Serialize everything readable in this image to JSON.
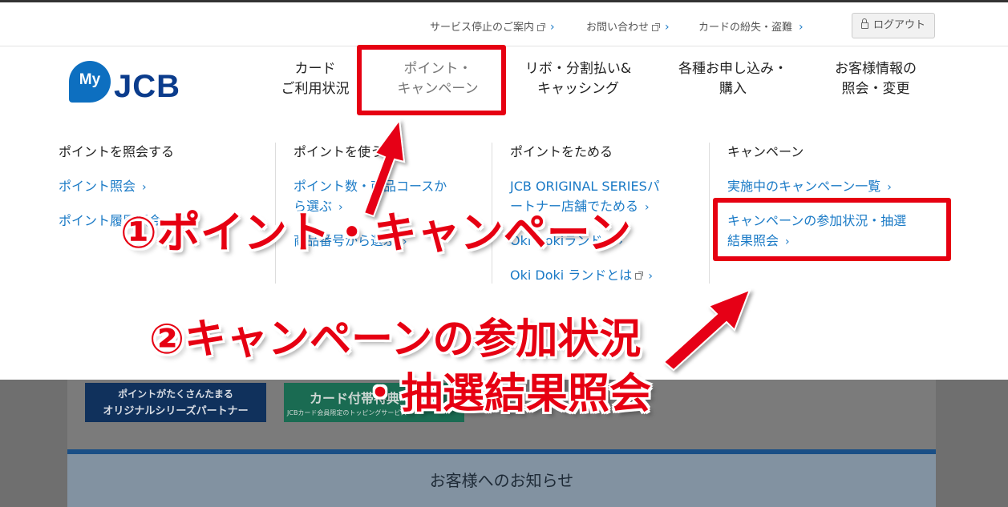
{
  "utility_nav": {
    "service_stop": "サービス停止のご案内",
    "contact": "お問い合わせ",
    "lost_card": "カードの紛失・盗難",
    "logout": "ログアウト"
  },
  "logo": {
    "my": "My",
    "jcb": "JCB"
  },
  "main_nav": [
    {
      "line1": "カード",
      "line2": "ご利用状況"
    },
    {
      "line1": "ポイント・",
      "line2": "キャンペーン"
    },
    {
      "line1": "リボ・分割払い&",
      "line2": "キャッシング"
    },
    {
      "line1": "各種お申し込み・",
      "line2": "購入"
    },
    {
      "line1": "お客様情報の",
      "line2": "照会・変更"
    }
  ],
  "menu": {
    "col1": {
      "heading": "ポイントを照会する",
      "link1": "ポイント照会",
      "link2": "ポイント履歴照会"
    },
    "col2": {
      "heading": "ポイントを使う",
      "link1a": "ポイント数・商品コースか",
      "link1b": "ら選ぶ",
      "link2": "商品番号から選ぶ"
    },
    "col3": {
      "heading": "ポイントをためる",
      "link1a": "JCB ORIGINAL SERIESパ",
      "link1b": "ートナー店舗でためる",
      "link2": "Oki Dokiランド",
      "link3": "Oki Doki ランドとは"
    },
    "col4": {
      "heading": "キャンペーン",
      "link1": "実施中のキャンペーン一覧",
      "link2a": "キャンペーンの参加状況・抽選",
      "link2b": "結果照会"
    }
  },
  "banners": {
    "banner1_line1": "ポイントがたくさんたまる",
    "banner1_line2": "オリジナルシリーズパートナー",
    "banner2_title": "カード付帯特典",
    "banner2_sub": "JCBカード会員限定のトッピングサービス"
  },
  "notice": "お客様へのお知らせ",
  "annotations": {
    "step1": "①ポイント・キャンペーン",
    "step2_line1": "②キャンペーンの参加状況",
    "step2_line2": "・抽選結果照会"
  },
  "colors": {
    "accent_red": "#e60012",
    "link_blue": "#1a7ac6",
    "jcb_navy": "#0b3c8c"
  }
}
